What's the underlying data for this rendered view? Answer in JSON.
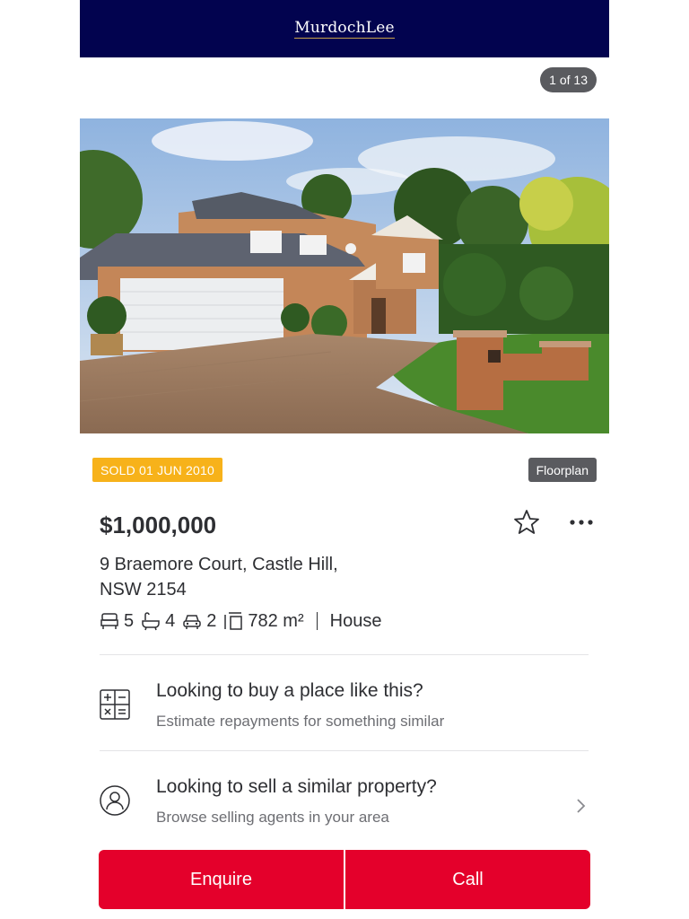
{
  "header": {
    "brand": "MurdochLee"
  },
  "gallery": {
    "counter": "1 of 13"
  },
  "listing": {
    "sold_badge": "SOLD 01 JUN 2010",
    "floorplan_label": "Floorplan",
    "price": "$1,000,000",
    "address_line1": "9 Braemore Court, Castle Hill,",
    "address_line2": "NSW 2154",
    "features": {
      "bedrooms": "5",
      "bathrooms": "4",
      "parking": "2",
      "land_size": "782 m²",
      "property_type": "House"
    }
  },
  "promos": [
    {
      "title": "Looking to buy a place like this?",
      "subtitle": "Estimate repayments for something similar",
      "icon": "calculator-icon"
    },
    {
      "title": "Looking to sell a similar property?",
      "subtitle": "Browse selling agents in your area",
      "icon": "agent-icon"
    }
  ],
  "actions": {
    "enquire_label": "Enquire",
    "call_label": "Call"
  },
  "colors": {
    "brand_bar": "#02034f",
    "sold_badge": "#f7b21a",
    "cta": "#e4002b",
    "text": "#2e2f33"
  }
}
